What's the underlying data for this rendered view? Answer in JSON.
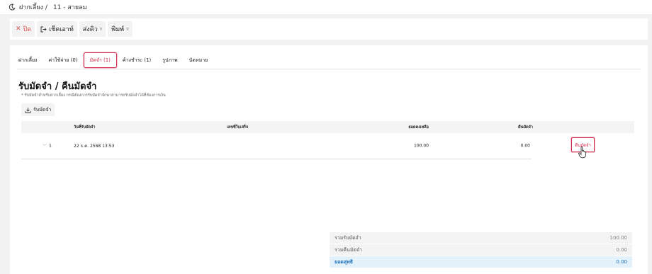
{
  "breadcrumb": {
    "section": "ฝากเลี้ยง /",
    "page": "11 -  สายลม"
  },
  "toolbar": {
    "close_label": "ปิด",
    "checkout_label": "เช็คเอาท์",
    "queue_label": "ส่งคิว",
    "print_label": "พิมพ์"
  },
  "tabs": [
    {
      "label": "ฝากเลี้ยง"
    },
    {
      "label": "ค่าใช้จ่าย (0)"
    },
    {
      "label": "มัดจำ (1)",
      "active": true
    },
    {
      "label": "ค้างชำระ (1)"
    },
    {
      "label": "รูปภาพ"
    },
    {
      "label": "นัดหมาย"
    }
  ],
  "section": {
    "title": "รับมัดจำ / คืนมัดจำ",
    "note": "* รับมัดจำสำหรับฝากเลี้ยง กรณีต้องการรับมัดจำจักษาสามารถรับมัดจำได้ที่ห้องการเงิน",
    "receive_button": "รับมัดจำ"
  },
  "table": {
    "headers": [
      "วันที่รับมัดจำ",
      "เลขที่ใบเสร็จ",
      "ยอดคงเหลือ",
      "คืนมัดจำ"
    ],
    "rows": [
      {
        "no": "1",
        "date": "22 ธ.ค. 2568 13:53",
        "receipt": "",
        "balance": "100.00",
        "returned": "0.00",
        "action": "คืนมัดจำ"
      }
    ]
  },
  "summary": [
    {
      "label": "รวมรับมัดจำ",
      "value": "100.00"
    },
    {
      "label": "รวมคืนมัดจำ",
      "value": "0.00"
    },
    {
      "label": "ยอดสุทธิ",
      "value": "0.00"
    }
  ],
  "colors": {
    "accent": "#d02a4a",
    "net": "#1d6fb8",
    "close": "#d9534f"
  }
}
